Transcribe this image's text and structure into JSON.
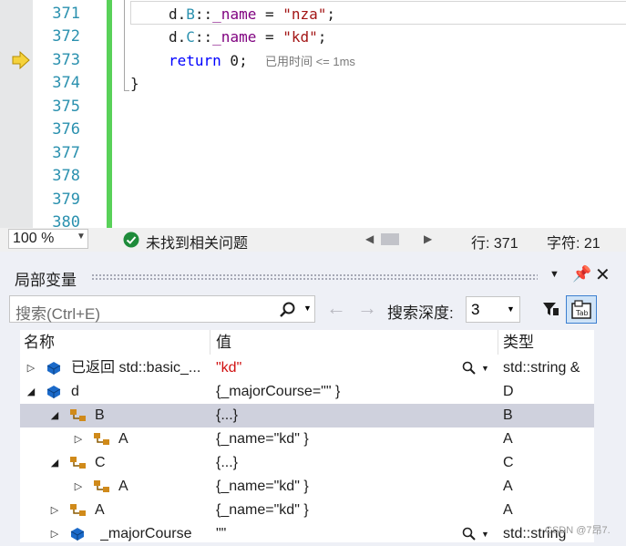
{
  "editor": {
    "line_numbers": [
      "371",
      "372",
      "373",
      "374",
      "375",
      "376",
      "377",
      "378",
      "379",
      "380"
    ],
    "code": {
      "l371_obj": "d.",
      "l371_cls": "B",
      "l371_sep": "::",
      "l371_mem": "_name",
      "l371_eq": " = ",
      "l371_str": "\"nza\"",
      "l371_end": ";",
      "l372_obj": "d.",
      "l372_cls": "C",
      "l372_sep": "::",
      "l372_mem": "_name",
      "l372_eq": " = ",
      "l372_str": "\"kd\"",
      "l372_end": ";",
      "l373_kw": "return",
      "l373_rest": " 0;",
      "l374": "}"
    },
    "elapsed_hint": "已用时间 <= 1ms"
  },
  "statusbar": {
    "zoom": "100 %",
    "issues": "未找到相关问题",
    "line": "行: 371",
    "char": "字符: 21"
  },
  "locals": {
    "title": "局部变量",
    "search_placeholder": "搜索(Ctrl+E)",
    "depth_label": "搜索深度:",
    "depth_value": "3",
    "columns": {
      "name": "名称",
      "value": "值",
      "type": "类型"
    },
    "rows": [
      {
        "name": "已返回 std::basic_...",
        "value": "\"kd\"",
        "type": "std::string &"
      },
      {
        "name": "d",
        "value": "{_majorCourse=\"\" }",
        "type": "D"
      },
      {
        "name": "B",
        "value": "{...}",
        "type": "B"
      },
      {
        "name": "A",
        "value": "{_name=\"kd\" }",
        "type": "A"
      },
      {
        "name": "C",
        "value": "{...}",
        "type": "C"
      },
      {
        "name": "A",
        "value": "{_name=\"kd\" }",
        "type": "A"
      },
      {
        "name": "A",
        "value": "{_name=\"kd\" }",
        "type": "A"
      },
      {
        "name": "_majorCourse",
        "value": "\"\"",
        "type": "std::string"
      }
    ]
  },
  "watermark": "CSDN @7昂7.",
  "colors": {
    "accent": "#2b91af",
    "change_bar": "#59d159",
    "selected_row": "#cfd1dd"
  }
}
